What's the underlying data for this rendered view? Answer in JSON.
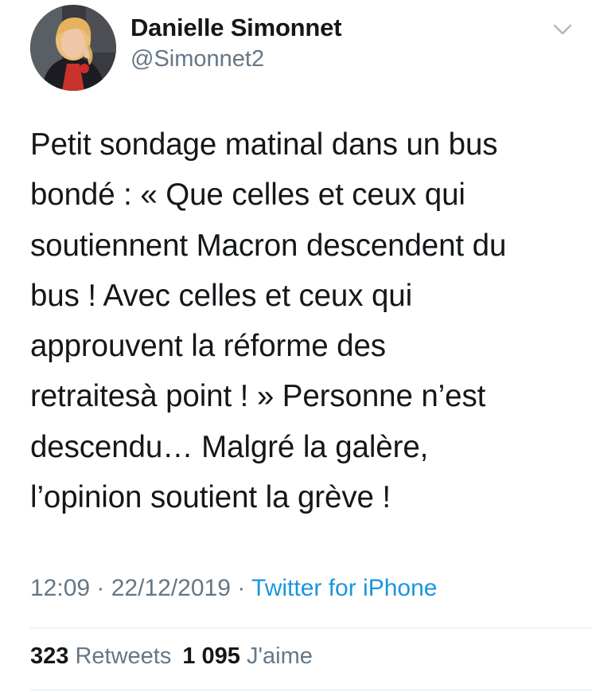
{
  "tweet": {
    "author": {
      "display_name": "Danielle Simonnet",
      "handle": "@Simonnet2"
    },
    "text": "Petit sondage matinal dans un bus\nbondé : « Que celles et ceux qui\nsoutiennent Macron descendent du\nbus ! Avec celles et ceux qui\napprouvent la réforme des\nretraitesà point ! » Personne n’est\ndescendu… Malgré la galère,\nl’opinion soutient la grève !",
    "time": "12:09",
    "separator1": " · ",
    "date": "22/12/2019",
    "separator2": " · ",
    "source": "Twitter for iPhone",
    "stats": {
      "retweets_count": "323",
      "retweets_label": "Retweets",
      "likes_count": "1 095",
      "likes_label": "J'aime"
    }
  },
  "colors": {
    "text": "#14171a",
    "secondary": "#657786",
    "link": "#1b95e0",
    "divider": "#e1e8ed"
  },
  "icons": {
    "menu": "chevron-down-icon",
    "avatar": "profile-photo"
  }
}
